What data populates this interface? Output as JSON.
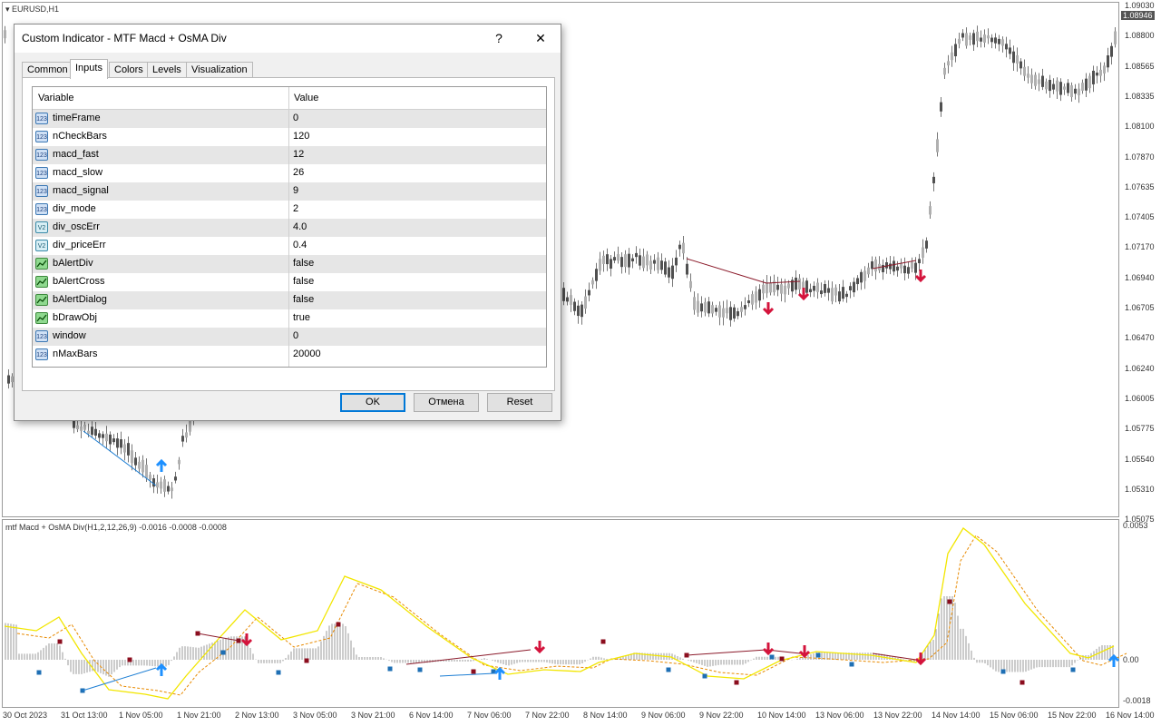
{
  "window": {
    "title": "EURUSD,H1"
  },
  "price_axis": {
    "labels": [
      "1.09030",
      "1.08800",
      "1.08565",
      "1.08335",
      "1.08100",
      "1.07870",
      "1.07635",
      "1.07405",
      "1.07170",
      "1.06940",
      "1.06705",
      "1.06470",
      "1.06240",
      "1.06005",
      "1.05775",
      "1.05540",
      "1.05310",
      "1.05075"
    ],
    "current_price": "1.08946"
  },
  "indicator": {
    "title": "mtf Macd + OsMA Div(H1,2,12,26,9) -0.0016 -0.0008 -0.0008",
    "axis_labels": [
      "0.0053",
      "0.00",
      "-0.0018"
    ]
  },
  "time_axis": {
    "labels": [
      "30 Oct 2023",
      "31 Oct 13:00",
      "1 Nov 05:00",
      "1 Nov 21:00",
      "2 Nov 13:00",
      "3 Nov 05:00",
      "3 Nov 21:00",
      "6 Nov 14:00",
      "7 Nov 06:00",
      "7 Nov 22:00",
      "8 Nov 14:00",
      "9 Nov 06:00",
      "9 Nov 22:00",
      "10 Nov 14:00",
      "13 Nov 06:00",
      "13 Nov 22:00",
      "14 Nov 14:00",
      "15 Nov 06:00",
      "15 Nov 22:00",
      "16 Nov 14:00"
    ]
  },
  "dialog": {
    "title": "Custom Indicator - MTF Macd + OsMA Div",
    "help_label": "?",
    "close_label": "✕",
    "tabs": [
      {
        "label": "Common",
        "active": false
      },
      {
        "label": "Inputs",
        "active": true
      },
      {
        "label": "Colors",
        "active": false
      },
      {
        "label": "Levels",
        "active": false
      },
      {
        "label": "Visualization",
        "active": false
      }
    ],
    "columns": {
      "variable": "Variable",
      "value": "Value"
    },
    "params": [
      {
        "icon": "int-icon",
        "icon_text": "123",
        "name": "timeFrame",
        "value": "0"
      },
      {
        "icon": "int-icon",
        "icon_text": "123",
        "name": "nCheckBars",
        "value": "120"
      },
      {
        "icon": "int-icon",
        "icon_text": "123",
        "name": "macd_fast",
        "value": "12"
      },
      {
        "icon": "int-icon",
        "icon_text": "123",
        "name": "macd_slow",
        "value": "26"
      },
      {
        "icon": "int-icon",
        "icon_text": "123",
        "name": "macd_signal",
        "value": "9"
      },
      {
        "icon": "int-icon",
        "icon_text": "123",
        "name": "div_mode",
        "value": "2"
      },
      {
        "icon": "double-icon",
        "icon_text": "V2",
        "name": "div_oscErr",
        "value": "4.0"
      },
      {
        "icon": "double-icon",
        "icon_text": "V2",
        "name": "div_priceErr",
        "value": "0.4"
      },
      {
        "icon": "bool-icon",
        "icon_text": "",
        "name": "bAlertDiv",
        "value": "false"
      },
      {
        "icon": "bool-icon",
        "icon_text": "",
        "name": "bAlertCross",
        "value": "false"
      },
      {
        "icon": "bool-icon",
        "icon_text": "",
        "name": "bAlertDialog",
        "value": "false"
      },
      {
        "icon": "bool-icon",
        "icon_text": "",
        "name": "bDrawObj",
        "value": "true"
      },
      {
        "icon": "int-icon",
        "icon_text": "123",
        "name": "window",
        "value": "0"
      },
      {
        "icon": "int-icon",
        "icon_text": "123",
        "name": "nMaxBars",
        "value": "20000"
      }
    ],
    "buttons": {
      "ok": "OK",
      "cancel": "Отмена",
      "reset": "Reset"
    }
  },
  "colors": {
    "bull_candle": "#b0b0b0",
    "bear_candle": "#505050",
    "sell_arrow": "#d4143c",
    "buy_arrow": "#1e90ff",
    "macd_line": "#f2e600",
    "signal_line": "#e88a00",
    "divergence_bear": "#8b1a2a",
    "divergence_bull": "#1e7fd4",
    "dialog_accent": "#0078d7"
  }
}
